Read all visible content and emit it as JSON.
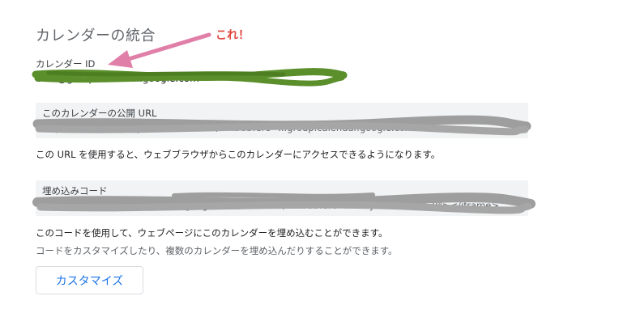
{
  "section": {
    "title": "カレンダーの統合"
  },
  "annotation": {
    "text": "これ！",
    "color": "#e0473f",
    "arrow_color": "#e07fa7"
  },
  "calendar_id": {
    "label": "カレンダー ID",
    "value": "bo...@group.calendar.google.com"
  },
  "public_url": {
    "label": "このカレンダーの公開 URL",
    "value": "https://calendar.google.com/calendar/embed?src=...group.calendar.google.com",
    "description": "この URL を使用すると、ウェブブラウザからこのカレンダーにアクセスできるようになります。"
  },
  "embed_code": {
    "label": "埋め込みコード",
    "value": "<iframe src=\"https://calendar.google.com/calendar/embed?src=...\" style=\"border: 0\"></iframe>",
    "description": "このコードを使用して、ウェブページにこのカレンダーを埋め込むことができます。",
    "description_secondary": "コードをカスタマイズしたり、複数のカレンダーを埋め込んだりすることができます。"
  },
  "customize_button": {
    "label": "カスタマイズ"
  },
  "colors": {
    "accent": "#1a73e8",
    "box_background": "#f1f3f4",
    "green_redaction": "#5a8f2b",
    "gray_redaction": "#9e9e9e"
  }
}
